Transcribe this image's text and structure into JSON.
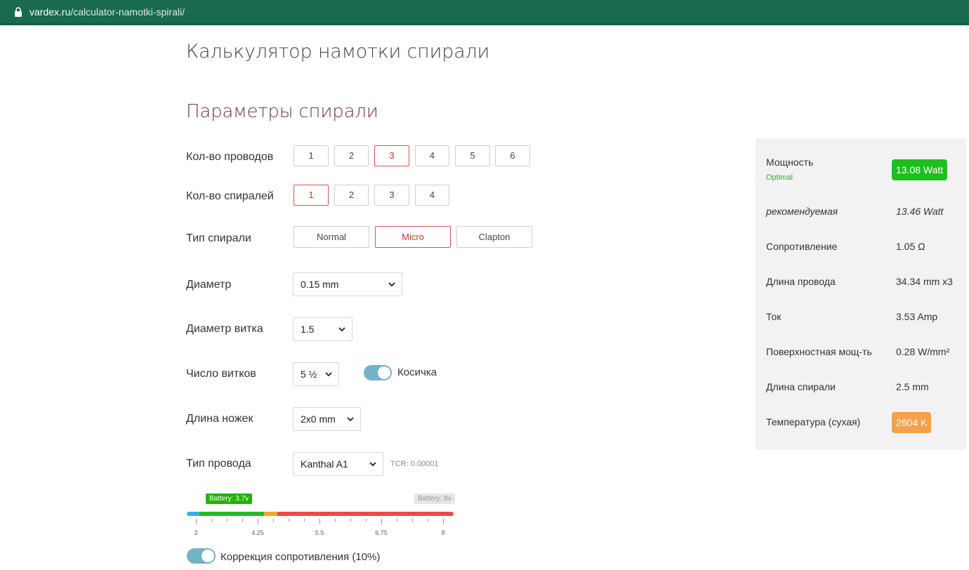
{
  "browser": {
    "domain": "vardex.ru",
    "path": "/calculator-namotki-spirali/"
  },
  "page": {
    "title": "Калькулятор намотки спирали",
    "section_title": "Параметры спирали"
  },
  "wires": {
    "label": "Кол-во проводов",
    "options": [
      "1",
      "2",
      "3",
      "4",
      "5",
      "6"
    ],
    "selected": "3"
  },
  "coils": {
    "label": "Кол-во спиралей",
    "options": [
      "1",
      "2",
      "3",
      "4"
    ],
    "selected": "1"
  },
  "coil_type": {
    "label": "Тип спирали",
    "options": [
      "Normal",
      "Micro",
      "Clapton"
    ],
    "selected": "Micro"
  },
  "diameter": {
    "label": "Диаметр",
    "value": "0.15 mm"
  },
  "inner_diameter": {
    "label": "Диаметр витка",
    "value": "1.5"
  },
  "wraps": {
    "label": "Число витков",
    "value": "5 ½",
    "braid_label": "Косичка",
    "braid_on": true
  },
  "legs": {
    "label": "Длина ножек",
    "value": "2x0 mm"
  },
  "wire_type": {
    "label": "Тип провода",
    "value": "Kanthal A1",
    "tcr": "TCR: 0.00001"
  },
  "battery": {
    "min_label": "Battery: 3.7v",
    "max_label": "Battery: 8v",
    "ticks": [
      "3",
      "4.25",
      "5.5",
      "6.75",
      "8"
    ],
    "colors": {
      "low": "#2fb4e9",
      "optimal": "#1fbe1f",
      "warn": "#f5a623",
      "high": "#f04848"
    }
  },
  "correction": {
    "label": "Коррекция сопротивления (10%)",
    "on": true
  },
  "results": {
    "power_label": "Мощность",
    "power_status": "Optimal",
    "power_value": "13.08 Watt",
    "power_color": "#1fbe1f",
    "recommended_label": "рекомендуемая",
    "recommended_value": "13.46 Watt",
    "resistance_label": "Сопротивление",
    "resistance_value": "1.05 Ω",
    "wire_length_label": "Длина провода",
    "wire_length_value": "34.34 mm x3",
    "current_label": "Ток",
    "current_value": "3.53 Amp",
    "surface_label": "Поверхностная мощ-ть",
    "surface_value": "0.28 W/mm²",
    "coil_length_label": "Длина спирали",
    "coil_length_value": "2.5 mm",
    "temperature_label": "Температура (сухая)",
    "temperature_value": "2604 K",
    "temperature_color": "#f5a04a"
  }
}
